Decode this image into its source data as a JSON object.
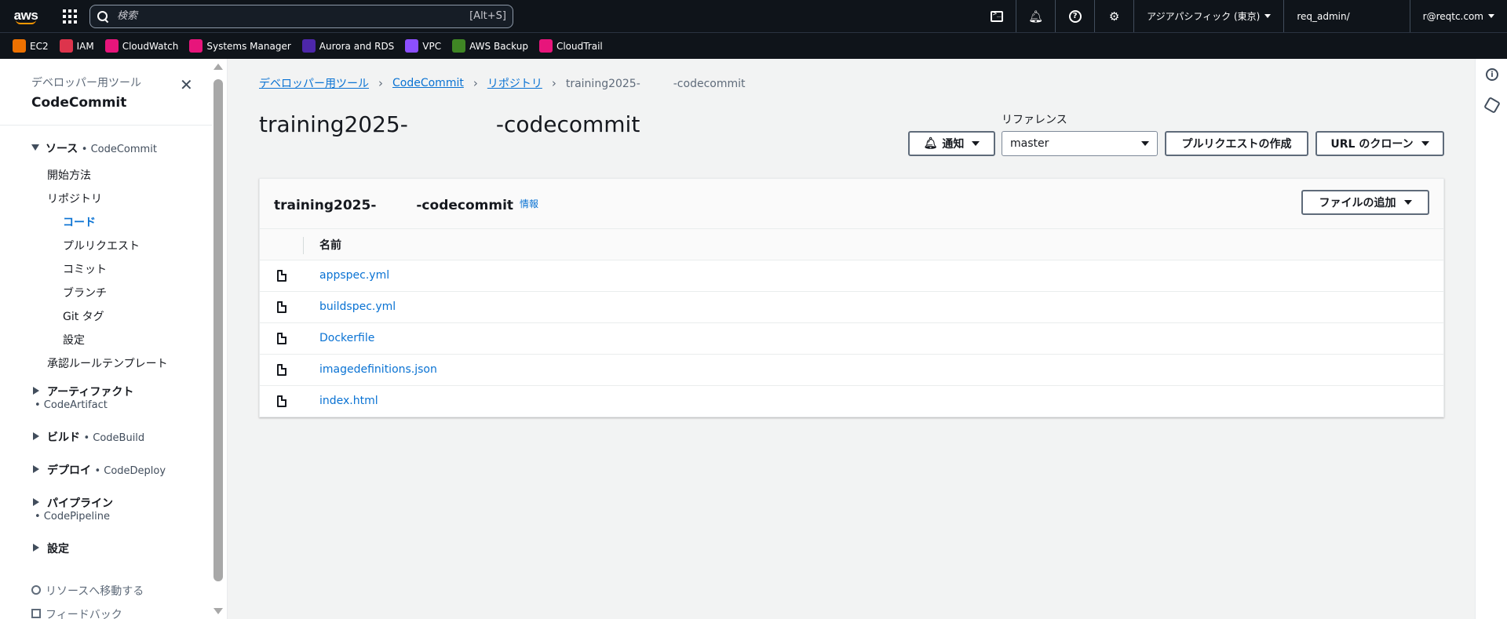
{
  "topnav": {
    "logo": "aws",
    "search_placeholder": "検索",
    "search_hint": "[Alt+S]",
    "region": "アジアパシフィック (東京)",
    "account": "req_admin/",
    "user": "r@reqtc.com"
  },
  "favorites": [
    {
      "label": "EC2",
      "color": "#ed7100",
      "icon": "ec2-icon"
    },
    {
      "label": "IAM",
      "color": "#dd344c",
      "icon": "iam-icon"
    },
    {
      "label": "CloudWatch",
      "color": "#e7157b",
      "icon": "cloudwatch-icon"
    },
    {
      "label": "Systems Manager",
      "color": "#e7157b",
      "icon": "systems-manager-icon"
    },
    {
      "label": "Aurora and RDS",
      "color": "#4d27aa",
      "icon": "rds-icon"
    },
    {
      "label": "VPC",
      "color": "#8c4fff",
      "icon": "vpc-icon"
    },
    {
      "label": "AWS Backup",
      "color": "#3f8624",
      "icon": "backup-icon"
    },
    {
      "label": "CloudTrail",
      "color": "#e7157b",
      "icon": "cloudtrail-icon"
    }
  ],
  "sidenav": {
    "subtitle": "デベロッパー用ツール",
    "title": "CodeCommit",
    "source_section": "ソース",
    "source_service": "• CodeCommit",
    "items": {
      "getting_started": "開始方法",
      "repositories": "リポジトリ",
      "code": "コード",
      "pull_requests": "プルリクエスト",
      "commits": "コミット",
      "branches": "ブランチ",
      "git_tags": "Git タグ",
      "settings": "設定",
      "approval_templates": "承認ルールテンプレート"
    },
    "artifacts": "アーティファクト",
    "artifacts_service": "• CodeArtifact",
    "build": "ビルド",
    "build_service": "• CodeBuild",
    "deploy": "デプロイ",
    "deploy_service": "• CodeDeploy",
    "pipeline": "パイプライン",
    "pipeline_service": "• CodePipeline",
    "settings_section": "設定",
    "goto_resource": "リソースへ移動する",
    "feedback": "フィードバック"
  },
  "breadcrumb": {
    "dev_tools": "デベロッパー用ツール",
    "codecommit": "CodeCommit",
    "repositories": "リポジトリ",
    "current": "training2025-　　　-codecommit"
  },
  "page": {
    "title": "training2025-　　　　-codecommit",
    "reference_label": "リファレンス",
    "notify_button": "通知",
    "reference_value": "master",
    "create_pr_button": "プルリクエストの作成",
    "clone_url_button": "URL のクローン"
  },
  "panel": {
    "title": "training2025-　　　-codecommit",
    "info": "情報",
    "add_file_button": "ファイルの追加",
    "column_name": "名前",
    "files": [
      "appspec.yml",
      "buildspec.yml",
      "Dockerfile",
      "imagedefinitions.json",
      "index.html"
    ]
  }
}
